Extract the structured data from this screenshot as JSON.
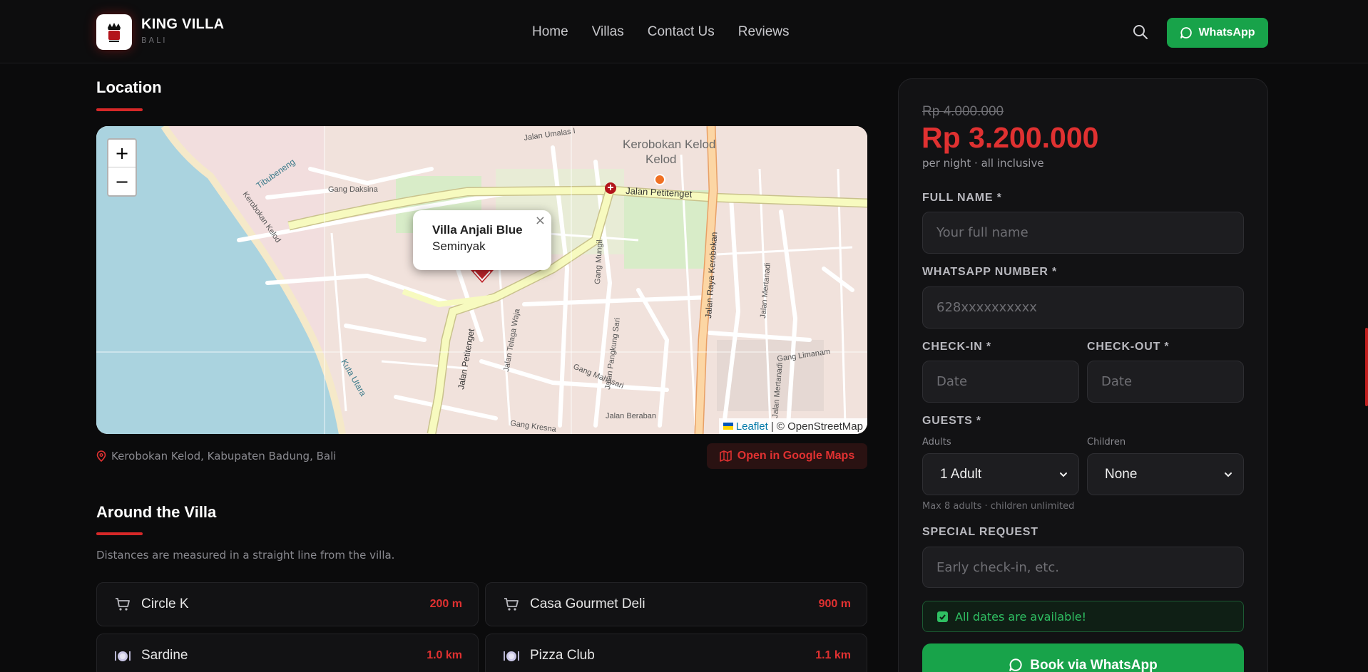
{
  "header": {
    "brand_name": "KING VILLA",
    "brand_sub": "BALI",
    "nav": [
      "Home",
      "Villas",
      "Contact Us",
      "Reviews"
    ],
    "whatsapp_label": "WhatsApp"
  },
  "location": {
    "title": "Location",
    "map": {
      "popup_title": "Villa Anjali Blue",
      "popup_subtitle": "Seminyak",
      "attribution_leaflet": "Leaflet",
      "attribution_osm": "| © OpenStreetMap",
      "labels": {
        "area": "Kerobokan Kelod",
        "area2": "Kelod",
        "petitenget_top": "Jalan Petitenget",
        "petitenget_side": "Jalan Petitenget",
        "raya_kerobokan": "Jalan Raya Kerobokan",
        "gang_daksina": "Gang Daksina",
        "kerobokan_kelod_road": "Kerobokan Kelod",
        "gang_mahasari": "Gang Mahasari",
        "pangkung_sari": "Jalan Pangkung Sari",
        "beraban": "Jalan Beraban",
        "kresna": "Gang Kresna",
        "mertanadi": "Jalan Mertanadi",
        "mertanadi2": "Jalan Mertanadi",
        "gang_limanam": "Gang Limanam",
        "gang_mungil": "Gang Mungil",
        "telaga_waja": "Jalan Telaga Waja",
        "tibubeneng": "Tibubeneng",
        "jalan_umalas": "Jalan Umalas I",
        "kuta_utara": "Kuta Utara"
      }
    },
    "address": "Kerobokan Kelod, Kabupaten Badung, Bali",
    "gmaps_label": "Open in Google Maps"
  },
  "around": {
    "title": "Around the Villa",
    "note": "Distances are measured in a straight line from the villa.",
    "items": [
      {
        "icon": "cart-icon",
        "name": "Circle K",
        "distance": "200 m"
      },
      {
        "icon": "cart-icon",
        "name": "Casa Gourmet Deli",
        "distance": "900 m"
      },
      {
        "icon": "dining-icon",
        "name": "Sardine",
        "distance": "1.0 km"
      },
      {
        "icon": "dining-icon",
        "name": "Pizza Club",
        "distance": "1.1 km"
      }
    ]
  },
  "booking": {
    "old_price": "Rp 4.000.000",
    "price": "Rp 3.200.000",
    "per_night": "per night · all inclusive",
    "full_name_label": "FULL NAME *",
    "full_name_placeholder": "Your full name",
    "whatsapp_label": "WHATSAPP NUMBER *",
    "whatsapp_placeholder": "628xxxxxxxxxx",
    "checkin_label": "CHECK-IN *",
    "checkout_label": "CHECK-OUT *",
    "date_placeholder": "Date",
    "guests_label": "GUESTS *",
    "adults_label": "Adults",
    "children_label": "Children",
    "adults_value": "1 Adult",
    "children_value": "None",
    "guest_hint": "Max 8 adults · children unlimited",
    "special_label": "SPECIAL REQUEST",
    "special_placeholder": "Early check-in, etc.",
    "availability": "All dates are available!",
    "book_label": "Book via WhatsApp"
  },
  "colors": {
    "accent_red": "#e03131",
    "whatsapp_green": "#18a34a",
    "background": "#0b0b0c"
  }
}
